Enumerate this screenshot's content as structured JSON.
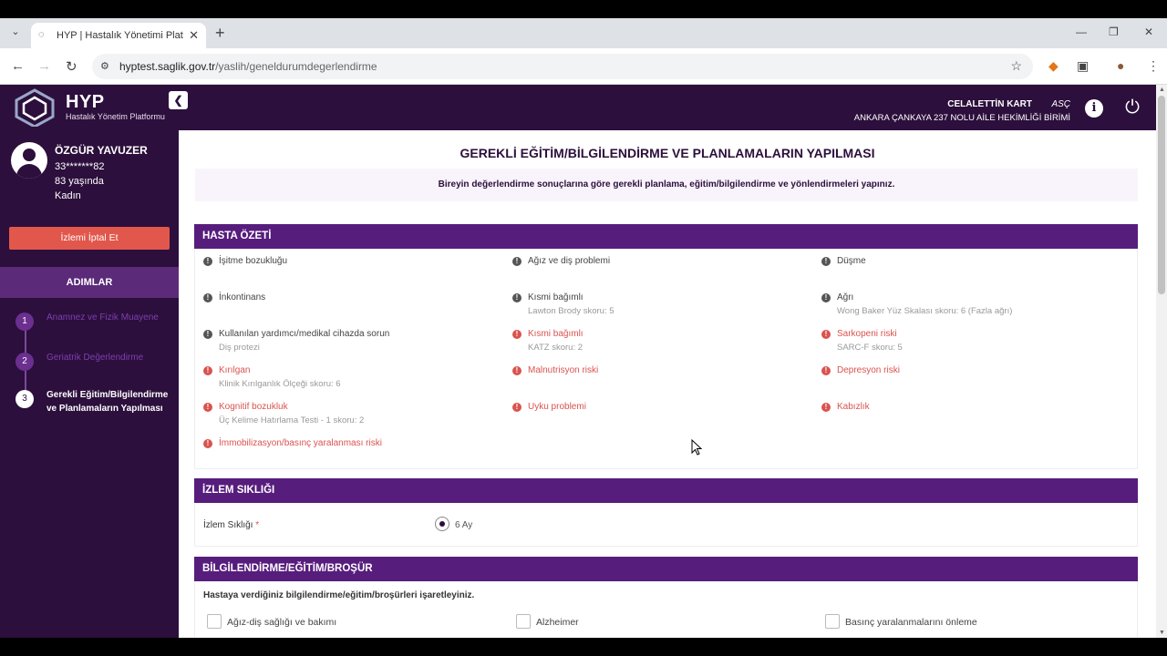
{
  "browser": {
    "tab_title": "HYP | Hastalık Yönetimi Platform",
    "url_host": "hyptest.saglik.gov.tr",
    "url_path": "/yaslih/geneldurumdegerlendirme"
  },
  "header": {
    "logo_title": "HYP",
    "logo_subtitle": "Hastalık Yönetim Platformu",
    "user_name": "CELALETTİN KART",
    "user_role": "ASÇ",
    "user_unit": "ANKARA ÇANKAYA 237 NOLU AİLE HEKİMLİĞİ BİRİMİ"
  },
  "patient": {
    "name": "ÖZGÜR YAVUZER",
    "id": "33*******82",
    "age": "83 yaşında",
    "sex": "Kadın",
    "cancel_label": "İzlemi İptal Et"
  },
  "steps": {
    "header": "ADIMLAR",
    "items": [
      {
        "num": "1",
        "label": "Anamnez ve Fizik Muayene"
      },
      {
        "num": "2",
        "label": "Geriatrik Değerlendirme"
      },
      {
        "num": "3",
        "label": "Gerekli Eğitim/Bilgilendirme ve Planlamaların Yapılması"
      }
    ]
  },
  "page": {
    "title": "GEREKLİ EĞİTİM/BİLGİLENDİRME VE PLANLAMALARIN YAPILMASI",
    "notice": "Bireyin değerlendirme sonuçlarına göre gerekli planlama, eğitim/bilgilendirme ve yönlendirmeleri yapınız."
  },
  "summary": {
    "title": "HASTA ÖZETİ",
    "items": [
      {
        "label": "İşitme bozukluğu",
        "sub": "",
        "status": "normal"
      },
      {
        "label": "Ağız ve diş problemi",
        "sub": "",
        "status": "normal"
      },
      {
        "label": "Düşme",
        "sub": "",
        "status": "normal"
      },
      {
        "label": "İnkontinans",
        "sub": "",
        "status": "normal"
      },
      {
        "label": "Kısmi bağımlı",
        "sub": "Lawton Brody skoru: 5",
        "status": "normal"
      },
      {
        "label": "Ağrı",
        "sub": "Wong Baker Yüz Skalası skoru: 6 (Fazla ağrı)",
        "status": "normal"
      },
      {
        "label": "Kullanılan yardımcı/medikal cihazda sorun",
        "sub": "Diş protezi",
        "status": "normal"
      },
      {
        "label": "Kısmi bağımlı",
        "sub": "KATZ skoru: 2",
        "status": "risk"
      },
      {
        "label": "Sarkopeni riski",
        "sub": "SARC-F skoru: 5",
        "status": "risk"
      },
      {
        "label": "Kırılgan",
        "sub": "Klinik Kırılganlık Ölçeği skoru: 6",
        "status": "risk"
      },
      {
        "label": "Malnutrisyon riski",
        "sub": "",
        "status": "risk"
      },
      {
        "label": "Depresyon riski",
        "sub": "",
        "status": "risk"
      },
      {
        "label": "Kognitif bozukluk",
        "sub": "Üç Kelime Hatırlama Testi - 1 skoru: 2",
        "status": "risk"
      },
      {
        "label": "Uyku problemi",
        "sub": "",
        "status": "risk"
      },
      {
        "label": "Kabızlık",
        "sub": "",
        "status": "risk"
      },
      {
        "label": "İmmobilizasyon/basınç yaralanması riski",
        "sub": "",
        "status": "risk"
      }
    ]
  },
  "frequency": {
    "title": "İZLEM SIKLIĞI",
    "label": "İzlem Sıklığı",
    "required": "*",
    "option": "6 Ay"
  },
  "education": {
    "title": "BİLGİLENDİRME/EĞİTİM/BROŞÜR",
    "instruction": "Hastaya verdiğiniz bilgilendirme/eğitim/broşürleri işaretleyiniz.",
    "options": [
      "Ağız-diş sağlığı ve bakımı",
      "Alzheimer",
      "Basınç yaralanmalarını önleme"
    ]
  },
  "colors": {
    "brand_dark": "#2c0f3c",
    "section_purple": "#571d7d",
    "risk_red": "#d9534f",
    "cancel_red": "#e2574c"
  }
}
